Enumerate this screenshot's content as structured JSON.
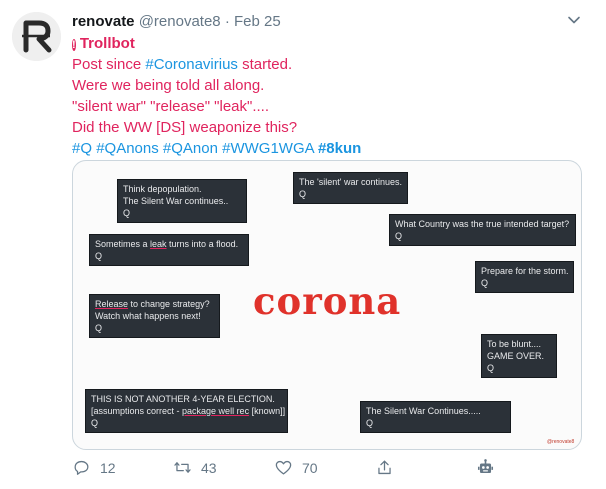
{
  "tweet": {
    "author_name": "renovate",
    "handle": "@renovate8",
    "separator": "·",
    "date": "Feb 25",
    "label": "Trollbot",
    "line1_prefix": "Post since ",
    "line1_tag": "#Coronavirius",
    "line1_suffix": " started.",
    "line2": "Were we being told all along.",
    "line3": "\"silent war\" \"release\" \"leak\"....",
    "line4": "Did the WW [DS] weaponize this?",
    "hashtags": [
      "#Q",
      "#QAnons",
      "#QAnon",
      "#WWG1WGA"
    ],
    "bold_hashtag": "#8kun"
  },
  "image": {
    "corona_word": "corona",
    "watermark": "@renovate8",
    "boxes": {
      "depop": {
        "l1": "Think depopulation.",
        "l2": "The Silent War continues..",
        "q": "Q"
      },
      "silent_war": {
        "l1": "The 'silent' war continues.",
        "q": "Q"
      },
      "country": {
        "l1": "What Country was the true intended target?",
        "q": "Q"
      },
      "leak": {
        "l1a": "Sometimes a ",
        "l1b": "leak",
        "l1c": " turns into a flood.",
        "q": "Q"
      },
      "storm": {
        "l1": "Prepare for the storm.",
        "q": "Q"
      },
      "release": {
        "l1a": "Release",
        "l1b": " to change strategy?",
        "l2": "Watch what happens next!",
        "q": "Q"
      },
      "blunt": {
        "l1": "To be blunt....",
        "l2": "GAME OVER.",
        "q": "Q"
      },
      "election": {
        "l1": "THIS IS NOT ANOTHER 4-YEAR ELECTION.",
        "l2a": "[assumptions correct - ",
        "l2b": "package well rec",
        "l2c": " [known]]",
        "q": "Q"
      },
      "silent_cont": {
        "l1": "The Silent War Continues.....",
        "q": "Q"
      }
    }
  },
  "actions": {
    "replies": "12",
    "retweets": "43",
    "likes": "70"
  },
  "colors": {
    "label_red": "#e0245e",
    "link_blue": "#1b95e0",
    "muted": "#657786"
  }
}
